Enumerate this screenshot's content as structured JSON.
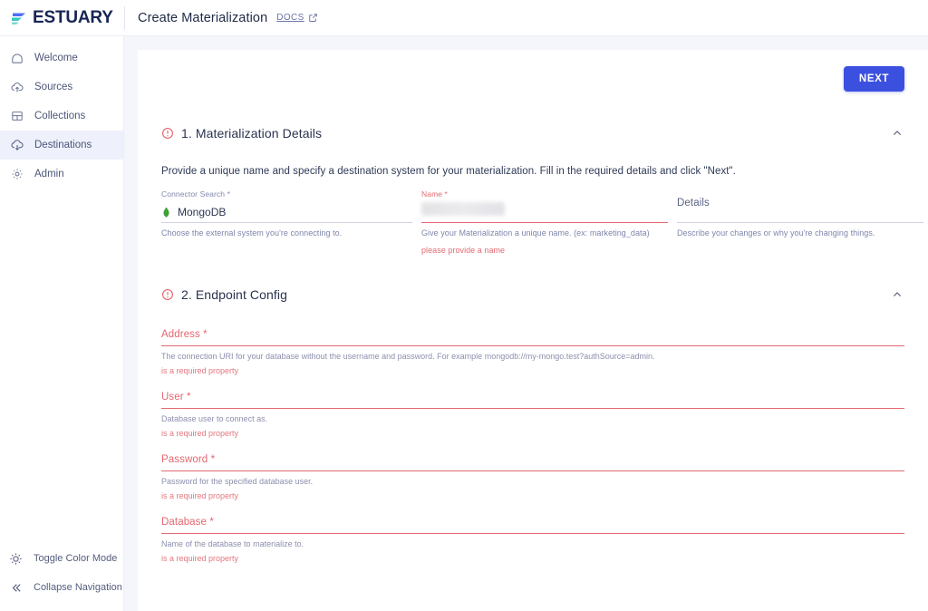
{
  "topbar": {
    "logo_text": "ESTUARY",
    "logo_icon": "estuary-logo-icon",
    "title": "Create Materialization",
    "docs_label": "DOCS",
    "docs_icon": "external-link-icon"
  },
  "sidebar": {
    "items": [
      {
        "label": "Welcome",
        "icon": "home-icon",
        "active": false
      },
      {
        "label": "Sources",
        "icon": "cloud-upload-icon",
        "active": false
      },
      {
        "label": "Collections",
        "icon": "collections-icon",
        "active": false
      },
      {
        "label": "Destinations",
        "icon": "cloud-download-icon",
        "active": true
      },
      {
        "label": "Admin",
        "icon": "gear-icon",
        "active": false
      }
    ],
    "footer": [
      {
        "label": "Toggle Color Mode",
        "icon": "sun-icon"
      },
      {
        "label": "Collapse Navigation",
        "icon": "chevron-double-left-icon"
      }
    ]
  },
  "main": {
    "next_label": "NEXT",
    "accent_color": "#3c50e0",
    "error_color": "#e4666f"
  },
  "section1": {
    "status_icon": "error-circle-icon",
    "title": "1. Materialization Details",
    "collapse_icon": "chevron-up-icon",
    "description": "Provide a unique name and specify a destination system for your materialization. Fill in the required details and click \"Next\".",
    "connector": {
      "label": "Connector Search *",
      "value": "MongoDB",
      "icon": "mongodb-leaf-icon",
      "icon_color": "#3fa037",
      "help": "Choose the external system you're connecting to."
    },
    "name": {
      "label": "Name *",
      "value": "",
      "redacted": true,
      "help": "Give your Materialization a unique name. (ex: marketing_data)",
      "error": "please provide a name"
    },
    "details": {
      "label": "Details",
      "value": "",
      "help": "Describe your changes or why you're changing things."
    }
  },
  "section2": {
    "status_icon": "error-circle-icon",
    "title": "2. Endpoint Config",
    "collapse_icon": "chevron-up-icon",
    "fields": [
      {
        "label": "Address",
        "required": true,
        "value": "",
        "help": "The connection URI for your database without the username and password. For example mongodb://my-mongo.test?authSource=admin.",
        "error": "is a required property"
      },
      {
        "label": "User",
        "required": true,
        "value": "",
        "help": "Database user to connect as.",
        "error": "is a required property"
      },
      {
        "label": "Password",
        "required": true,
        "value": "",
        "help": "Password for the specified database user.",
        "error": "is a required property"
      },
      {
        "label": "Database",
        "required": true,
        "value": "",
        "help": "Name of the database to materialize to.",
        "error": "is a required property"
      }
    ]
  }
}
